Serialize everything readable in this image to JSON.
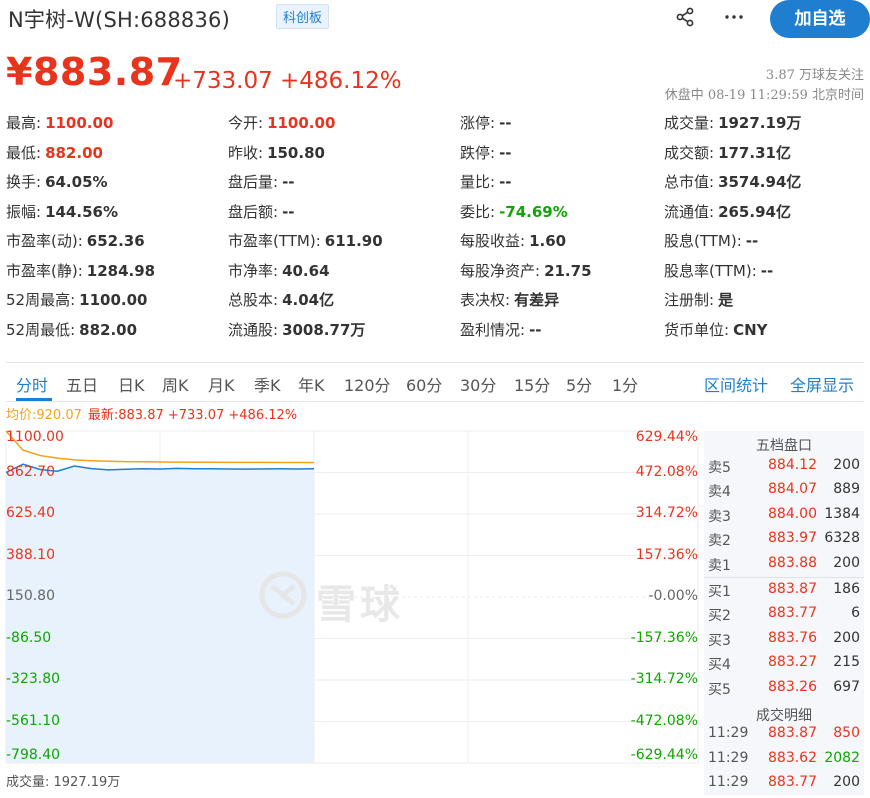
{
  "header": {
    "title": "N宇树-W(SH:688836)",
    "badge": "科创板",
    "share_icon": "share-icon",
    "more_icon": "more-icon",
    "follow_button": "加自选"
  },
  "quote": {
    "price": "¥883.87",
    "change": "+733.07",
    "change_pct": "+486.12%",
    "followers": "3.87 万球友关注",
    "status": "休盘中 08-19 11:29:59 北京时间"
  },
  "colors": {
    "up": "#e8341d",
    "down": "#0ea600",
    "accent": "#1f7ed0",
    "avg_line": "#f4a21c"
  },
  "stats": [
    [
      {
        "label": "最高:",
        "value": "1100.00",
        "color": "red"
      },
      {
        "label": "今开:",
        "value": "1100.00",
        "color": "red"
      },
      {
        "label": "涨停:",
        "value": "--",
        "color": ""
      },
      {
        "label": "成交量:",
        "value": "1927.19万",
        "color": ""
      }
    ],
    [
      {
        "label": "最低:",
        "value": "882.00",
        "color": "red"
      },
      {
        "label": "昨收:",
        "value": "150.80",
        "color": ""
      },
      {
        "label": "跌停:",
        "value": "--",
        "color": ""
      },
      {
        "label": "成交额:",
        "value": "177.31亿",
        "color": ""
      }
    ],
    [
      {
        "label": "换手:",
        "value": "64.05%",
        "color": ""
      },
      {
        "label": "盘后量:",
        "value": "--",
        "color": ""
      },
      {
        "label": "量比:",
        "value": "--",
        "color": ""
      },
      {
        "label": "总市值:",
        "value": "3574.94亿",
        "color": ""
      }
    ],
    [
      {
        "label": "振幅:",
        "value": "144.56%",
        "color": ""
      },
      {
        "label": "盘后额:",
        "value": "--",
        "color": ""
      },
      {
        "label": "委比:",
        "value": "-74.69%",
        "color": "green"
      },
      {
        "label": "流通值:",
        "value": "265.94亿",
        "color": ""
      }
    ],
    [
      {
        "label": "市盈率(动):",
        "value": "652.36",
        "color": ""
      },
      {
        "label": "市盈率(TTM):",
        "value": "611.90",
        "color": ""
      },
      {
        "label": "每股收益:",
        "value": "1.60",
        "color": ""
      },
      {
        "label": "股息(TTM):",
        "value": "--",
        "color": ""
      }
    ],
    [
      {
        "label": "市盈率(静):",
        "value": "1284.98",
        "color": ""
      },
      {
        "label": "市净率:",
        "value": "40.64",
        "color": ""
      },
      {
        "label": "每股净资产:",
        "value": "21.75",
        "color": ""
      },
      {
        "label": "股息率(TTM):",
        "value": "--",
        "color": ""
      }
    ],
    [
      {
        "label": "52周最高:",
        "value": "1100.00",
        "color": ""
      },
      {
        "label": "总股本:",
        "value": "4.04亿",
        "color": ""
      },
      {
        "label": "表决权:",
        "value": "有差异",
        "color": ""
      },
      {
        "label": "注册制:",
        "value": "是",
        "color": ""
      }
    ],
    [
      {
        "label": "52周最低:",
        "value": "882.00",
        "color": ""
      },
      {
        "label": "流通股:",
        "value": "3008.77万",
        "color": ""
      },
      {
        "label": "盈利情况:",
        "value": "--",
        "color": ""
      },
      {
        "label": "货币单位:",
        "value": "CNY",
        "color": ""
      }
    ]
  ],
  "tabs": {
    "periods": [
      "分时",
      "五日",
      "日K",
      "周K",
      "月K",
      "季K",
      "年K",
      "120分",
      "60分",
      "30分",
      "15分",
      "5分",
      "1分"
    ],
    "active": "分时",
    "range_stats": "区间统计",
    "fullscreen": "全屏显示"
  },
  "chart_info": {
    "avg": "均价:920.07",
    "latest": "最新:883.87 +733.07 +486.12%",
    "volume": "成交量: 1927.19万",
    "watermark": "雪球"
  },
  "chart_data": {
    "type": "line",
    "y_labels_left": [
      "1100.00",
      "862.70",
      "625.40",
      "388.10",
      "150.80",
      "-86.50",
      "-323.80",
      "-561.10",
      "-798.40"
    ],
    "y_labels_right": [
      "629.44%",
      "472.08%",
      "314.72%",
      "157.36%",
      "-0.00%",
      "-157.36%",
      "-314.72%",
      "-472.08%",
      "-629.44%"
    ],
    "ylim": [
      -798.4,
      1100.0
    ],
    "prev_close": 150.8,
    "series": [
      {
        "name": "最新",
        "color": "#1f7ed0",
        "values": [
          862.7,
          910,
          880,
          870,
          900,
          885,
          878,
          881,
          884,
          883,
          886,
          884,
          884,
          883,
          882,
          883,
          884,
          883,
          883.87
        ]
      },
      {
        "name": "均价",
        "color": "#f4a21c",
        "values": [
          1100,
          990,
          960,
          945,
          935,
          930,
          927,
          925,
          924,
          923,
          922,
          921.5,
          921,
          920.8,
          920.5,
          920.3,
          920.2,
          920.1,
          920.07
        ]
      }
    ]
  },
  "order_book": {
    "title": "五档盘口",
    "asks": [
      {
        "label": "卖5",
        "price": "884.12",
        "volume": "200"
      },
      {
        "label": "卖4",
        "price": "884.07",
        "volume": "889"
      },
      {
        "label": "卖3",
        "price": "884.00",
        "volume": "1384"
      },
      {
        "label": "卖2",
        "price": "883.97",
        "volume": "6328"
      },
      {
        "label": "卖1",
        "price": "883.88",
        "volume": "200"
      }
    ],
    "bids": [
      {
        "label": "买1",
        "price": "883.87",
        "volume": "186"
      },
      {
        "label": "买2",
        "price": "883.77",
        "volume": "6"
      },
      {
        "label": "买3",
        "price": "883.76",
        "volume": "200"
      },
      {
        "label": "买4",
        "price": "883.27",
        "volume": "215"
      },
      {
        "label": "买5",
        "price": "883.26",
        "volume": "697"
      }
    ]
  },
  "trades": {
    "title": "成交明细",
    "rows": [
      {
        "time": "11:29",
        "price": "883.87",
        "volume": "850",
        "color": "red"
      },
      {
        "time": "11:29",
        "price": "883.62",
        "volume": "2082",
        "color": "green"
      },
      {
        "time": "11:29",
        "price": "883.77",
        "volume": "200",
        "color": "gray"
      }
    ]
  }
}
